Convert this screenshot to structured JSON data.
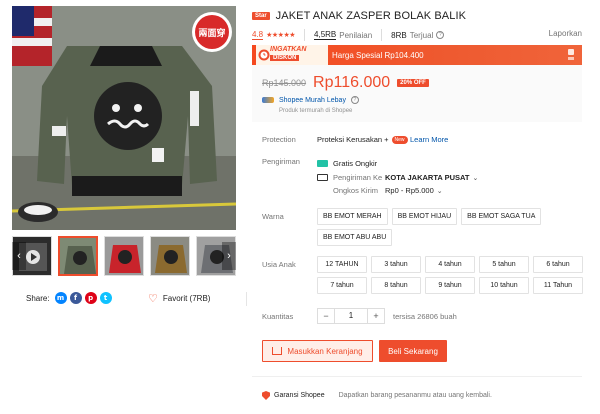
{
  "product": {
    "badge": "Star",
    "title": "JAKET ANAK ZASPER BOLAK BALIK",
    "rating": "4.8",
    "stars": "★★★★★",
    "reviews_count": "4,5RB",
    "reviews_label": "Penilaian",
    "sold_count": "8RB",
    "sold_label": "Terjual",
    "report": "Laporkan"
  },
  "flash": {
    "logo_top": "INGATKAN",
    "logo_bottom": "DISKON",
    "text": "Harga Spesial Rp104.400"
  },
  "price": {
    "old": "Rp145.000",
    "new": "Rp116.000",
    "discount": "20% OFF",
    "promo_link": "Shopee Murah Lebay",
    "promo_sub": "Produk termurah di Shopee"
  },
  "protection": {
    "label": "Protection",
    "text": "Proteksi Kerusakan +",
    "new_badge": "New",
    "learn_more": "Learn More"
  },
  "shipping": {
    "label": "Pengiriman",
    "free": "Gratis Ongkir",
    "to_label": "Pengiriman Ke",
    "to_value": "KOTA JAKARTA PUSAT",
    "cost_label": "Ongkos Kirim",
    "cost_value": "Rp0 - Rp5.000"
  },
  "color": {
    "label": "Warna",
    "options": [
      "BB EMOT MERAH",
      "BB EMOT HIJAU",
      "BB EMOT SAGA TUA",
      "BB EMOT ABU ABU"
    ]
  },
  "size": {
    "label": "Usia Anak",
    "options": [
      "12 TAHUN",
      "3 tahun",
      "4 tahun",
      "5 tahun",
      "6 tahun",
      "7 tahun",
      "8 tahun",
      "9 tahun",
      "10 tahun",
      "11 Tahun"
    ]
  },
  "quantity": {
    "label": "Kuantitas",
    "value": "1",
    "minus": "−",
    "plus": "+",
    "stock": "tersisa 26806 buah"
  },
  "actions": {
    "cart": "Masukkan Keranjang",
    "buy": "Beli Sekarang"
  },
  "guarantee": {
    "title": "Garansi Shopee",
    "desc": "Dapatkan barang pesananmu atau uang kembali."
  },
  "share": {
    "label": "Share:",
    "favorite": "Favorit (7RB)",
    "icons": [
      "messenger-icon",
      "facebook-icon",
      "pinterest-icon",
      "twitter-icon"
    ]
  },
  "gallery": {
    "main_tag": "兩面穿",
    "nav_prev": "‹",
    "nav_next": "›"
  },
  "colors": {
    "accent": "#ee4d2d",
    "link": "#0055aa",
    "jacket": "#58624f"
  }
}
